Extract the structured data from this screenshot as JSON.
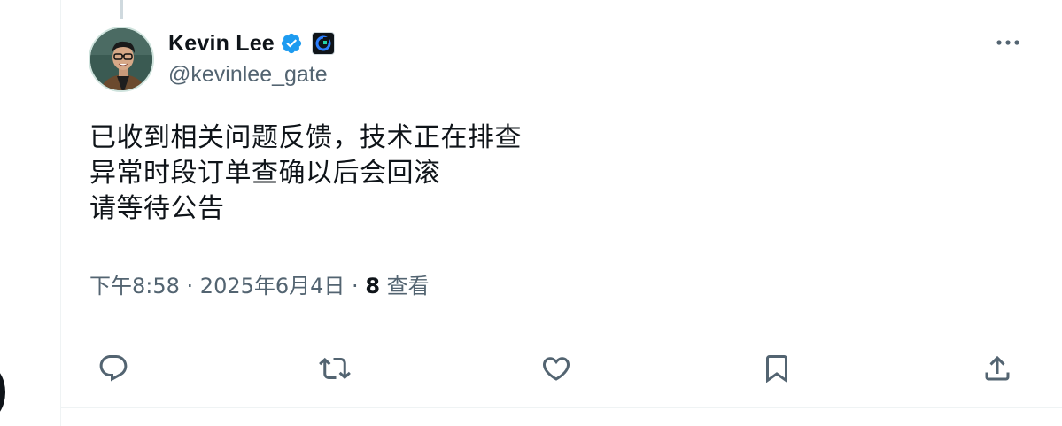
{
  "author": {
    "display_name": "Kevin Lee",
    "handle": "@kevinlee_gate",
    "verified": true,
    "affiliate_badge": "gate-logo-icon"
  },
  "tweet": {
    "lines": [
      "已收到相关问题反馈，技术正在排查",
      "异常时段订单查确以后会回滚",
      "请等待公告"
    ]
  },
  "meta": {
    "time": "下午8:58",
    "separator": " · ",
    "date": "2025年6月4日",
    "views_count": "8",
    "views_label": " 查看"
  },
  "actions": [
    {
      "name": "reply",
      "icon": "reply-icon"
    },
    {
      "name": "retweet",
      "icon": "retweet-icon"
    },
    {
      "name": "like",
      "icon": "heart-icon"
    },
    {
      "name": "bookmark",
      "icon": "bookmark-icon"
    },
    {
      "name": "share",
      "icon": "share-icon"
    }
  ],
  "colors": {
    "text_primary": "#0f1419",
    "text_secondary": "#536471",
    "verified_blue": "#1d9bf0",
    "divider": "#eff3f4"
  }
}
